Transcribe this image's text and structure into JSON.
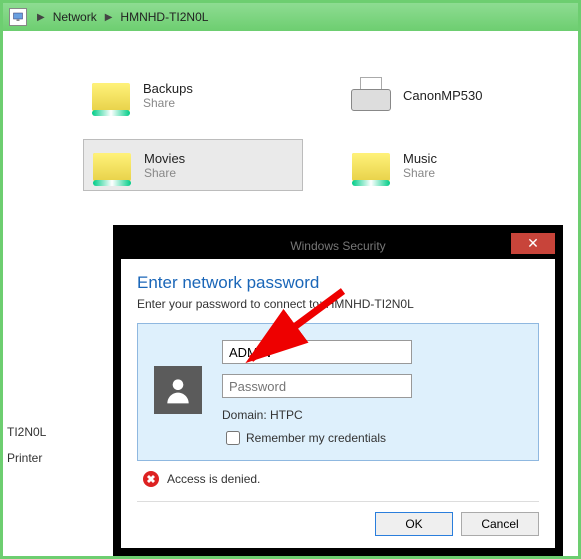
{
  "breadcrumb": {
    "network": "Network",
    "host": "HMNHD-TI2N0L"
  },
  "shares": {
    "backups": {
      "name": "Backups",
      "sub": "Share"
    },
    "printer": {
      "name": "CanonMP530"
    },
    "movies": {
      "name": "Movies",
      "sub": "Share"
    },
    "music": {
      "name": "Music",
      "sub": "Share"
    }
  },
  "sidebar": {
    "host_short": "TI2N0L",
    "printer": "Printer"
  },
  "dialog": {
    "title": "Windows Security",
    "heading": "Enter network password",
    "subtext": "Enter your password to connect to: HMNHD-TI2N0L",
    "username": "ADMIN",
    "password_placeholder": "Password",
    "domain_label": "Domain: HTPC",
    "remember_label": "Remember my credentials",
    "error": "Access is denied.",
    "ok": "OK",
    "cancel": "Cancel"
  }
}
